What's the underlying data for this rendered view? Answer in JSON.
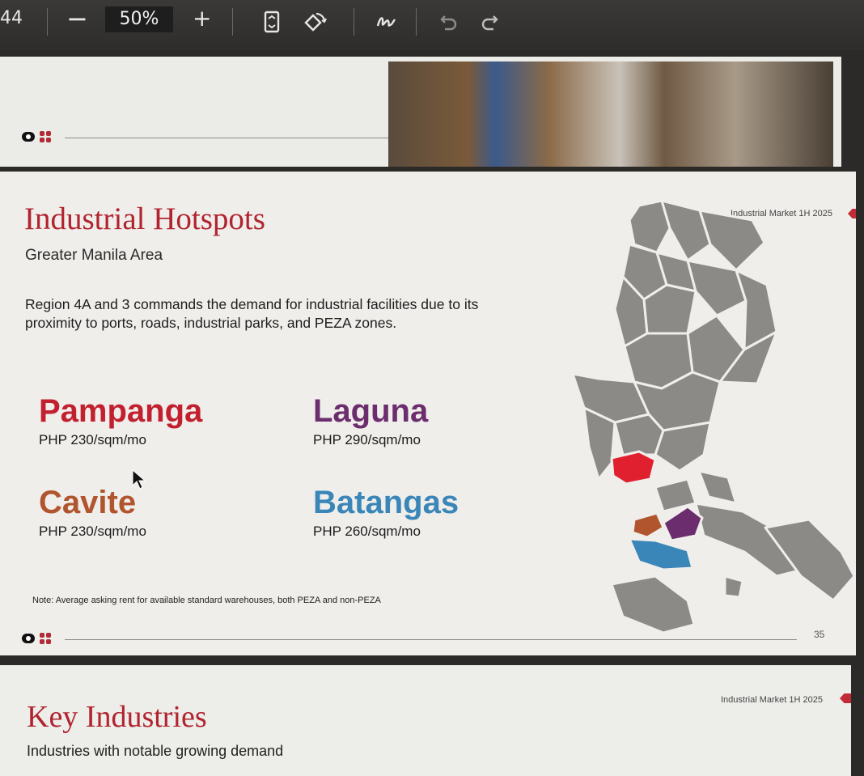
{
  "toolbar": {
    "page_number": "44",
    "zoom_out_label": "−",
    "zoom_value": "50%",
    "zoom_in_label": "+",
    "icons": [
      "page-fit-icon",
      "rotate-icon",
      "draw-icon",
      "undo-icon",
      "redo-icon"
    ]
  },
  "slide_main": {
    "title": "Industrial Hotspots",
    "subtitle": "Greater Manila Area",
    "description": "Region 4A and 3 commands the demand for industrial facilities due to its proximity to ports, roads, industrial parks, and PEZA zones.",
    "market_tag": "Industrial Market 1H 2025",
    "locations": [
      {
        "name": "Pampanga",
        "price": "PHP 230/sqm/mo",
        "color": "#c3202f"
      },
      {
        "name": "Laguna",
        "price": "PHP 290/sqm/mo",
        "color": "#6b2d6e"
      },
      {
        "name": "Cavite",
        "price": "PHP 230/sqm/mo",
        "color": "#b0552e"
      },
      {
        "name": "Batangas",
        "price": "PHP 260/sqm/mo",
        "color": "#3a86b8"
      }
    ],
    "note": "Note: Average asking rent for available standard warehouses, both PEZA and non-PEZA",
    "page_number": "35"
  },
  "slide_next": {
    "title": "Key Industries",
    "subtitle": "Industries with notable growing demand",
    "market_tag": "Industrial Market 1H 2025"
  },
  "colors": {
    "accent_red": "#b1232f",
    "map_gray": "#8c8a87"
  }
}
